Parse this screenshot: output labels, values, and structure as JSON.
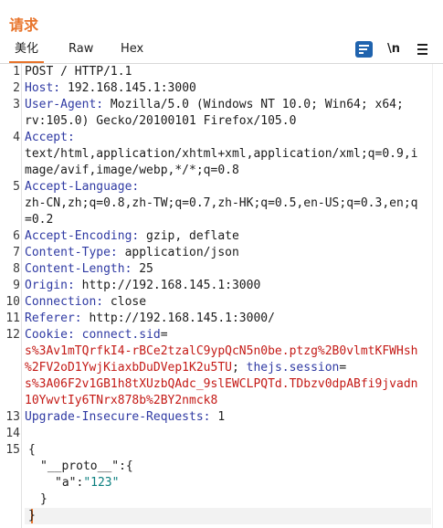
{
  "panel": {
    "title": "请求"
  },
  "tabs": [
    {
      "label": "美化",
      "active": true
    },
    {
      "label": "Raw",
      "active": false
    },
    {
      "label": "Hex",
      "active": false
    }
  ],
  "toolbar": {
    "wrap_icon": "wrap-lines-icon",
    "newline_label": "\\n",
    "menu_icon": "hamburger-menu-icon"
  },
  "colors": {
    "accent": "#e8742b",
    "header_key": "#2f3aa3",
    "cookie_value": "#c41a16",
    "json_string": "#0a7e7e",
    "wrap_button": "#1f63ae"
  },
  "request": {
    "line_numbers": [
      "1",
      "2",
      "3",
      "4",
      "5",
      "6",
      "7",
      "8",
      "9",
      "10",
      "11",
      "12",
      "13",
      "14",
      "15"
    ],
    "request_line": "POST / HTTP/1.1",
    "host_key": "Host:",
    "host_val": " 192.168.145.1:3000",
    "ua_key": "User-Agent:",
    "ua_val1": " Mozilla/5.0 (Windows NT 10.0; Win64; x64;",
    "ua_val2": "rv:105.0) Gecko/20100101 Firefox/105.0",
    "accept_key": "Accept:",
    "accept_val1": "text/html,application/xhtml+xml,application/xml;q=0.9,i",
    "accept_val2": "mage/avif,image/webp,*/*;q=0.8",
    "lang_key": "Accept-Language:",
    "lang_val1": "zh-CN,zh;q=0.8,zh-TW;q=0.7,zh-HK;q=0.5,en-US;q=0.3,en;q",
    "lang_val2": "=0.2",
    "enc_key": "Accept-Encoding:",
    "enc_val": " gzip, deflate",
    "ct_key": "Content-Type:",
    "ct_val": " application/json",
    "cl_key": "Content-Length:",
    "cl_val": " 25",
    "origin_key": "Origin:",
    "origin_val": " http://192.168.145.1:3000",
    "conn_key": "Connection:",
    "conn_val": " close",
    "ref_key": "Referer:",
    "ref_val": " http://192.168.145.1:3000/",
    "cookie_key": "Cookie:",
    "cookie_name1": " connect.sid",
    "cookie_val1a": "s%3Av1mTQrfkI4-rBCe2tzalC9ypQcN5n0be.ptzg%2B0vlmtKFWHsh",
    "cookie_val1b": "%2FV2oD1YwjKiaxbDuDVep1K2u5TU",
    "cookie_name2": " thejs.session",
    "cookie_val2a": "s%3A06F2v1GB1h8tXUzbQAdc_9slEWCLPQTd.TDbzv0dpABfi9jvadn",
    "cookie_val2b": "10YwvtIy6TNrx878b%2BY2nmck8",
    "uir_key": "Upgrade-Insecure-Requests:",
    "uir_val": " 1"
  },
  "body_json": {
    "open_brace": "{",
    "proto_key": "\"__proto__\"",
    "proto_open": ":{",
    "a_key": "\"a\"",
    "colon": ":",
    "a_val": "\"123\"",
    "inner_close": "}",
    "outer_close": "}"
  }
}
